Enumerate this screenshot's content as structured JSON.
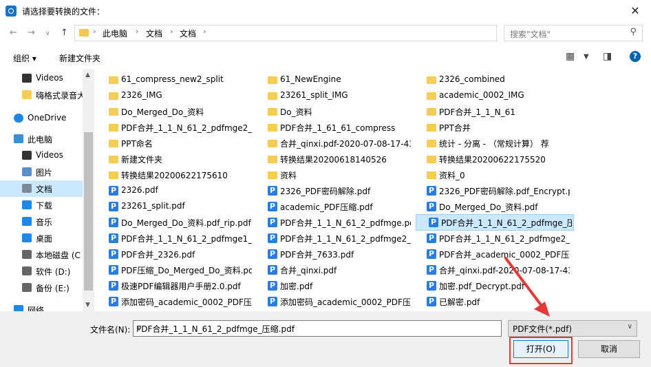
{
  "window": {
    "title": "请选择要转换的文件：",
    "close": "✕"
  },
  "address": {
    "crumbs": [
      "此电脑",
      "文档",
      "文档"
    ],
    "search_placeholder": "搜索\"文档\""
  },
  "toolbar": {
    "organize": "组织 ▾",
    "new_folder": "新建文件夹"
  },
  "nav": [
    {
      "label": "Videos",
      "icon": "video-icon"
    },
    {
      "label": "嗨格式录音大",
      "icon": "folder-icon"
    },
    {
      "label": "OneDrive",
      "icon": "cloud-icon"
    },
    {
      "label": "此电脑",
      "icon": "computer-icon"
    },
    {
      "label": "Videos",
      "icon": "video-icon"
    },
    {
      "label": "图片",
      "icon": "picture-icon"
    },
    {
      "label": "文档",
      "icon": "document-icon"
    },
    {
      "label": "下载",
      "icon": "download-icon"
    },
    {
      "label": "音乐",
      "icon": "music-icon"
    },
    {
      "label": "桌面",
      "icon": "desktop-icon"
    },
    {
      "label": "本地磁盘 (C",
      "icon": "drive-icon"
    },
    {
      "label": "软件 (D:)",
      "icon": "drive-icon"
    },
    {
      "label": "备份 (E:)",
      "icon": "drive-icon"
    },
    {
      "label": "网络",
      "icon": "network-icon"
    }
  ],
  "files": {
    "col1": [
      {
        "name": "61_compress_new2_split",
        "type": "folder"
      },
      {
        "name": "2326_IMG",
        "type": "folder"
      },
      {
        "name": "Do_Merged_Do_资料",
        "type": "folder"
      },
      {
        "name": "PDF合并_1_1_N_61_2_pdfmge2_sp...",
        "type": "folder"
      },
      {
        "name": "PPT命名",
        "type": "folder"
      },
      {
        "name": "新建文件夹",
        "type": "folder"
      },
      {
        "name": "转换结果20200622175610",
        "type": "folder"
      },
      {
        "name": "2326.pdf",
        "type": "pdf"
      },
      {
        "name": "23261_split.pdf",
        "type": "pdf"
      },
      {
        "name": "Do_Merged_Do_资料.pdf_rip.pdf",
        "type": "pdf"
      },
      {
        "name": "PDF合并_1_1_N_61_2_pdfmge1_sp...",
        "type": "pdf"
      },
      {
        "name": "PDF合并_2326.pdf",
        "type": "pdf"
      },
      {
        "name": "PDF压缩_Do_Merged_Do_资料.pd...",
        "type": "pdf"
      },
      {
        "name": "极速PDF编辑器用户手册2.0.pdf",
        "type": "pdf"
      },
      {
        "name": "添加密码_academic_0002_PDF压缩...",
        "type": "pdf"
      }
    ],
    "col2": [
      {
        "name": "61_NewEngine",
        "type": "folder"
      },
      {
        "name": "23261_split_IMG",
        "type": "folder"
      },
      {
        "name": "Do_资料",
        "type": "folder"
      },
      {
        "name": "PDF合并_1_61_61_compress",
        "type": "folder"
      },
      {
        "name": "合并_qinxi.pdf-2020-07-08-17-43-...",
        "type": "folder"
      },
      {
        "name": "转换结果20200618140526",
        "type": "folder"
      },
      {
        "name": "资料",
        "type": "folder"
      },
      {
        "name": "2326_PDF密码解除.pdf",
        "type": "pdf"
      },
      {
        "name": "academic_PDF压缩.pdf",
        "type": "pdf"
      },
      {
        "name": "PDF合并_1_1_N_61_2_pdfmge.pdf",
        "type": "pdf"
      },
      {
        "name": "PDF合并_1_1_N_61_2_pdfmge2_sp...",
        "type": "pdf"
      },
      {
        "name": "PDF合并_7633.pdf",
        "type": "pdf"
      },
      {
        "name": "合并_qinxi.pdf",
        "type": "pdf"
      },
      {
        "name": "加密.pdf",
        "type": "pdf"
      },
      {
        "name": "添加密码_academic_0002_PDF压缩...",
        "type": "pdf"
      }
    ],
    "col3": [
      {
        "name": "2326_combined",
        "type": "folder"
      },
      {
        "name": "academic_0002_IMG",
        "type": "folder"
      },
      {
        "name": "PDF合并_1_1_N_61",
        "type": "folder"
      },
      {
        "name": "PPT合并",
        "type": "folder"
      },
      {
        "name": "统计 - 分离 - （常规计算） 荐",
        "type": "folder"
      },
      {
        "name": "转换结果20200622175520",
        "type": "folder"
      },
      {
        "name": "资料_0",
        "type": "folder"
      },
      {
        "name": "2326_PDF密码解除.pdf_Encrypt.pdf",
        "type": "pdf"
      },
      {
        "name": "Do_Merged_Do_资料.pdf",
        "type": "pdf"
      },
      {
        "name": "PDF合并_1_1_N_61_2_pdfmge_压...",
        "type": "pdf"
      },
      {
        "name": "PDF合并_1_1_N_61_2_pdfmge2_sp...",
        "type": "pdf"
      },
      {
        "name": "PDF合并_academic_0002_PDF压缩_2326...",
        "type": "pdf"
      },
      {
        "name": "合并_qinxi.pdf-2020-07-08-17-43-...",
        "type": "pdf"
      },
      {
        "name": "加密.pdf_Decrypt.pdf",
        "type": "pdf"
      },
      {
        "name": "已解密.pdf",
        "type": "pdf"
      }
    ]
  },
  "bottom": {
    "filename_label": "文件名(N):",
    "filename_value": "PDF合并_1_1_N_61_2_pdfmge_压缩.pdf",
    "filter": "PDF文件(*.pdf)",
    "open": "打开(O)",
    "cancel": "取消"
  }
}
